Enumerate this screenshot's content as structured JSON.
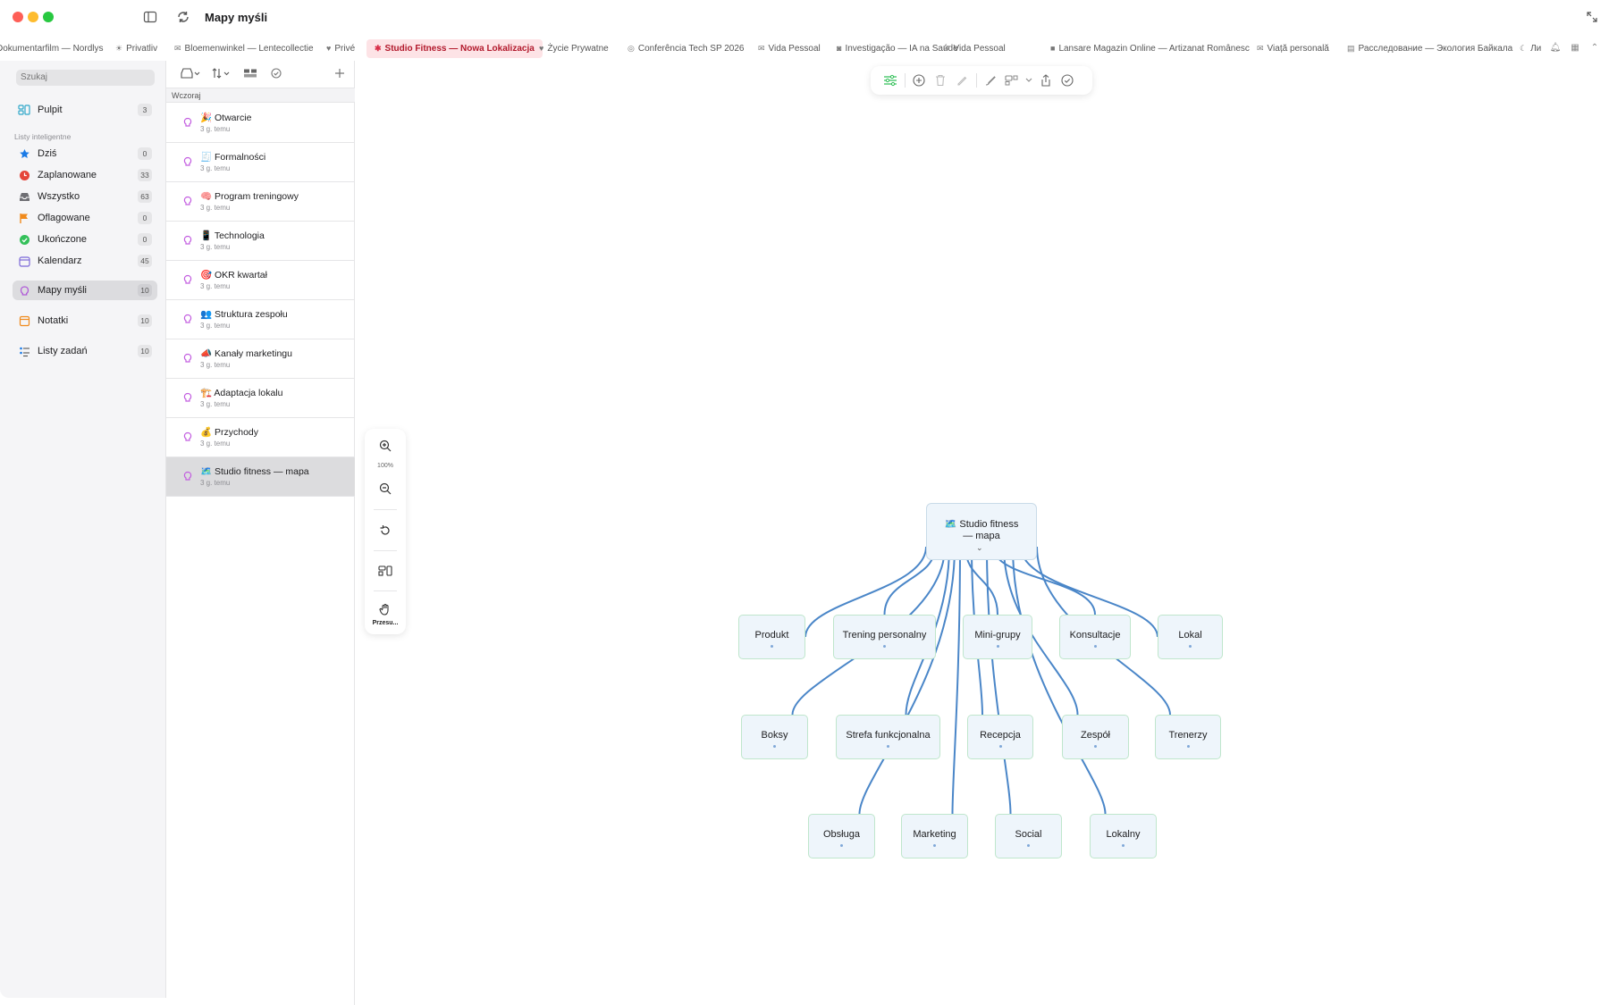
{
  "window": {
    "title": "Mapy myśli"
  },
  "tabs": [
    {
      "label": "Dokumentarfilm — Nordlys",
      "icon": "list-icon"
    },
    {
      "label": "Privatliv",
      "icon": "sun-icon"
    },
    {
      "label": "Bloemenwinkel — Lentecollectie",
      "icon": "mail-icon"
    },
    {
      "label": "Privé",
      "icon": "heart-icon"
    },
    {
      "label": "Studio Fitness — Nowa Lokalizacja",
      "icon": "pin-icon",
      "active": true
    },
    {
      "label": "Życie Prywatne",
      "icon": "heart-icon"
    },
    {
      "label": "Conferência Tech SP 2026",
      "icon": "globe-icon"
    },
    {
      "label": "Vida Pessoal",
      "icon": "mail-icon"
    },
    {
      "label": "Investigação — IA na Saúde",
      "icon": "camera-icon"
    },
    {
      "label": "Vida Pessoal",
      "icon": "mail-icon"
    },
    {
      "label": "Lansare Magazin Online — Artizanat Românesc",
      "icon": "bag-icon"
    },
    {
      "label": "Viață personală",
      "icon": "mail-icon"
    },
    {
      "label": "Расследование — Экология Байкала",
      "icon": "doc-icon"
    },
    {
      "label": "Ли",
      "icon": "moon-icon"
    }
  ],
  "sidebar": {
    "search_placeholder": "Szukaj",
    "smart_lists_label": "Listy inteligentne",
    "items": [
      {
        "label": "Pulpit",
        "count": "3"
      },
      {
        "label": "Dziś",
        "count": "0"
      },
      {
        "label": "Zaplanowane",
        "count": "33"
      },
      {
        "label": "Wszystko",
        "count": "63"
      },
      {
        "label": "Oflagowane",
        "count": "0"
      },
      {
        "label": "Ukończone",
        "count": "0"
      },
      {
        "label": "Kalendarz",
        "count": "45"
      },
      {
        "label": "Mapy myśli",
        "count": "10"
      },
      {
        "label": "Notatki",
        "count": "10"
      },
      {
        "label": "Listy zadań",
        "count": "10"
      }
    ],
    "colors": {
      "accent_blue": "#1a7ae6",
      "red": "#e5453a",
      "orange": "#f08a1c",
      "green": "#34c05a",
      "purple": "#b05ad8"
    }
  },
  "list": {
    "group_label": "Wczoraj",
    "items": [
      {
        "emoji": "🎉",
        "title": "Otwarcie",
        "subtitle": "3 g. temu"
      },
      {
        "emoji": "🧾",
        "title": "Formalności",
        "subtitle": "3 g. temu"
      },
      {
        "emoji": "🧠",
        "title": "Program treningowy",
        "subtitle": "3 g. temu"
      },
      {
        "emoji": "📱",
        "title": "Technologia",
        "subtitle": "3 g. temu"
      },
      {
        "emoji": "🎯",
        "title": "OKR kwartał",
        "subtitle": "3 g. temu"
      },
      {
        "emoji": "👥",
        "title": "Struktura zespołu",
        "subtitle": "3 g. temu"
      },
      {
        "emoji": "📣",
        "title": "Kanały marketingu",
        "subtitle": "3 g. temu"
      },
      {
        "emoji": "🏗️",
        "title": "Adaptacja lokalu",
        "subtitle": "3 g. temu"
      },
      {
        "emoji": "💰",
        "title": "Przychody",
        "subtitle": "3 g. temu"
      },
      {
        "emoji": "🗺️",
        "title": "Studio fitness — mapa",
        "subtitle": "3 g. temu",
        "selected": true
      }
    ]
  },
  "zoom": {
    "value": "100%",
    "pan_label": "Przesu..."
  },
  "mindmap": {
    "root": {
      "emoji": "🗺️",
      "line1": "Studio fitness",
      "line2": "— mapa"
    },
    "nodes": [
      "Produkt",
      "Trening personalny",
      "Mini-grupy",
      "Konsultacje",
      "Lokal",
      "Boksy",
      "Strefa funkcjonalna",
      "Recepcja",
      "Zespół",
      "Trenerzy",
      "Obsługa",
      "Marketing",
      "Social",
      "Lokalny"
    ],
    "edge_color": "#4a86c8"
  }
}
